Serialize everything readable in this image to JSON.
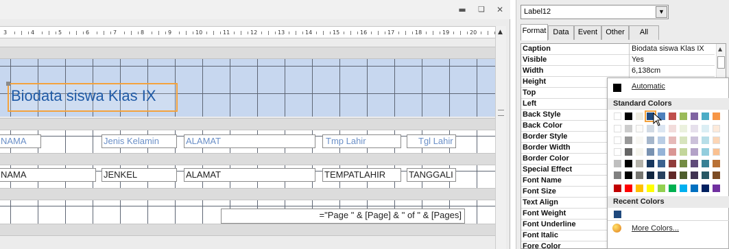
{
  "designer": {
    "ruler_numbers": [
      "3",
      "4",
      "5",
      "6",
      "7",
      "8",
      "9",
      "10",
      "11",
      "12",
      "13",
      "14",
      "15",
      "16",
      "17",
      "18",
      "19",
      "20"
    ],
    "title_label": "Biodata siswa Klas IX",
    "header_labels": [
      "NAMA",
      "Jenis Kelamin",
      "ALAMAT",
      "Tmp Lahir",
      "Tgl Lahir"
    ],
    "detail_fields": [
      "NAMA",
      "JENKEL",
      "ALAMAT",
      "TEMPATLAHIR",
      "TANGGALI"
    ],
    "footer_expr": "=\"Page \" & [Page] & \" of \" & [Pages]"
  },
  "props": {
    "selected_object": "Label12",
    "tabs": [
      "Format",
      "Data",
      "Event",
      "Other",
      "All"
    ],
    "active_tab": "Format",
    "rows": [
      {
        "name": "Caption",
        "value": "Biodata siswa Klas IX"
      },
      {
        "name": "Visible",
        "value": "Yes"
      },
      {
        "name": "Width",
        "value": "6,138cm"
      },
      {
        "name": "Height",
        "value": ""
      },
      {
        "name": "Top",
        "value": ""
      },
      {
        "name": "Left",
        "value": ""
      },
      {
        "name": "Back Style",
        "value": ""
      },
      {
        "name": "Back Color",
        "value": ""
      },
      {
        "name": "Border Style",
        "value": ""
      },
      {
        "name": "Border Width",
        "value": ""
      },
      {
        "name": "Border Color",
        "value": ""
      },
      {
        "name": "Special Effect",
        "value": ""
      },
      {
        "name": "Font Name",
        "value": ""
      },
      {
        "name": "Font Size",
        "value": ""
      },
      {
        "name": "Text Align",
        "value": ""
      },
      {
        "name": "Font Weight",
        "value": ""
      },
      {
        "name": "Font Underline",
        "value": ""
      },
      {
        "name": "Font Italic",
        "value": ""
      },
      {
        "name": "Fore Color",
        "value": "#1F497D"
      }
    ]
  },
  "color_picker": {
    "automatic_label": "Automatic",
    "standard_header": "Standard Colors",
    "recent_header": "Recent Colors",
    "more_label": "More Colors...",
    "top_row": [
      "#ffffff",
      "#000000",
      "#eeece1",
      "#1f497d",
      "#4f81bd",
      "#c0504d",
      "#9bbb59",
      "#8064a2",
      "#4bacc6",
      "#f79646"
    ],
    "selected_color": "#1f497d",
    "recent": [
      "#1f497d"
    ],
    "bottom_row": [
      "#c00000",
      "#ff0000",
      "#ffc000",
      "#ffff00",
      "#92d050",
      "#00b050",
      "#00b0f0",
      "#0070c0",
      "#002060",
      "#7030a0"
    ]
  }
}
